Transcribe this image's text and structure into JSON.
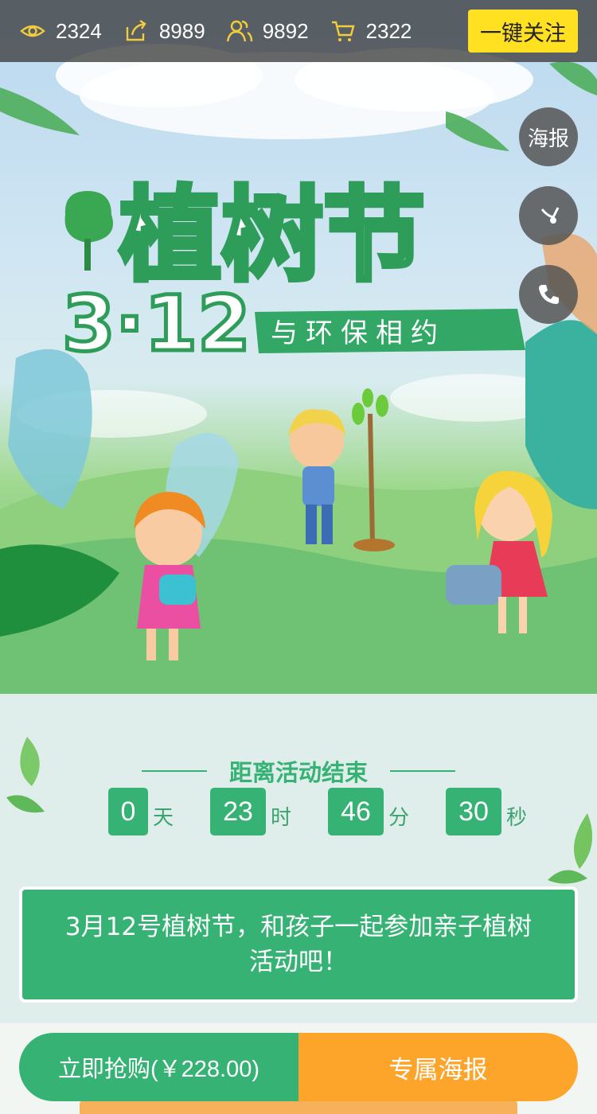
{
  "stats": [
    {
      "icon": "eye-icon",
      "value": "2324"
    },
    {
      "icon": "share-icon",
      "value": "8989"
    },
    {
      "icon": "users-icon",
      "value": "9892"
    },
    {
      "icon": "cart-icon",
      "value": "2322"
    }
  ],
  "follow_label": "一键关注",
  "side": {
    "poster_label": "海报"
  },
  "hero": {
    "title": "植树节",
    "date": "3·12",
    "subtitle": "与环保相约"
  },
  "countdown": {
    "title": "距离活动结束",
    "days": "0",
    "days_unit": "天",
    "hours": "23",
    "hours_unit": "时",
    "minutes": "46",
    "minutes_unit": "分",
    "seconds": "30",
    "seconds_unit": "秒"
  },
  "announcement": "3月12号植树节，和孩子一起参加亲子植树活动吧！",
  "bottom": {
    "buy_label": "立即抢购(￥228.00)",
    "poster_label": "专属海报"
  },
  "colors": {
    "accent_green": "#35b274",
    "accent_orange": "#fda52b",
    "follow_yellow": "#ffe122"
  }
}
